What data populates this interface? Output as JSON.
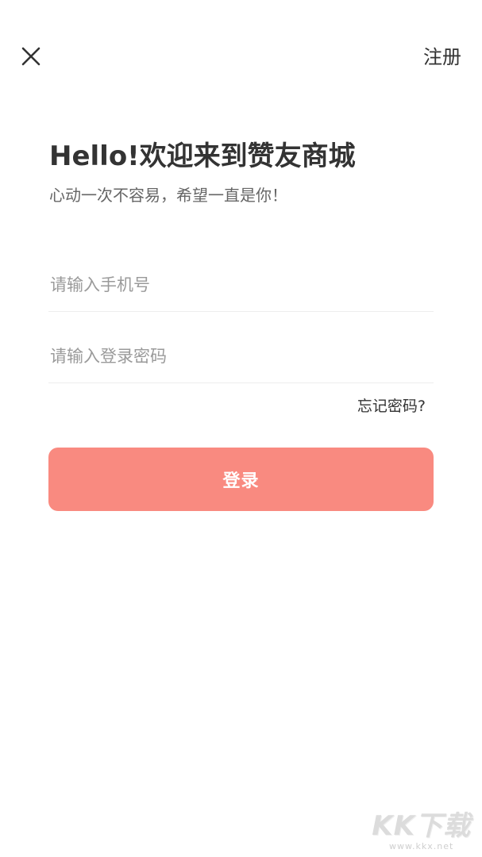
{
  "header": {
    "close_icon": "close-icon",
    "register_label": "注册"
  },
  "welcome": {
    "title": "Hello!欢迎来到赞友商城",
    "subtitle": "心动一次不容易，希望一直是你！"
  },
  "form": {
    "phone_placeholder": "请输入手机号",
    "phone_value": "",
    "password_placeholder": "请输入登录密码",
    "password_value": "",
    "forgot_label": "忘记密码?",
    "login_label": "登录"
  },
  "colors": {
    "accent": "#f98a80",
    "text_primary": "#333333",
    "text_secondary": "#666666",
    "placeholder": "#9a9a9a",
    "divider": "#ededed"
  },
  "watermark": {
    "logo": "KK下载",
    "url": "www.kkx.net"
  }
}
